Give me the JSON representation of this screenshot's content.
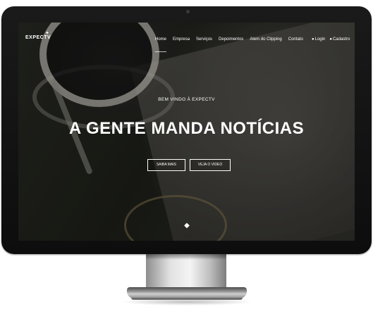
{
  "brand": {
    "logo_text": "EXPECTV"
  },
  "nav": {
    "links": [
      "Home",
      "Empresa",
      "Serviços",
      "Depoimentos",
      "Alem do Clipping",
      "Contato"
    ],
    "login_label": "Login",
    "signup_label": "Cadastro"
  },
  "hero": {
    "welcome": "BEM VINDO À EXPECTV",
    "headline": "A GENTE MANDA NOTÍCIAS",
    "primary_button": "SAIBA MAIS",
    "secondary_button": "VEJA O VIDEO"
  },
  "icons": {
    "login": "user-icon",
    "signup": "user-icon",
    "scroll": "diamond-icon"
  },
  "colors": {
    "text": "#ffffff",
    "bezel": "#111111",
    "stand": "#d9d9d9"
  }
}
